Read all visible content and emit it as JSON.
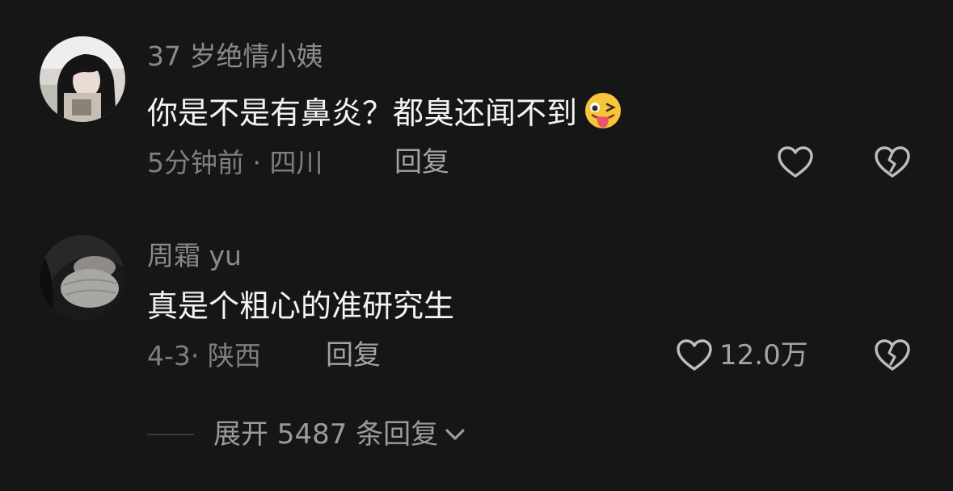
{
  "comments": [
    {
      "username": "37 岁绝情小姨",
      "text": "你是不是有鼻炎？都臭还闻不到",
      "emoji": "winking-tongue-face",
      "time_location": "5分钟前 · 四川",
      "reply_label": "回复",
      "like_count": ""
    },
    {
      "username": "周霜 yu",
      "text": "真是个粗心的准研究生",
      "time_location": "4-3· 陕西",
      "reply_label": "回复",
      "like_count": "12.0万"
    }
  ],
  "expand": {
    "label": "展开 5487 条回复"
  },
  "colors": {
    "background": "#161616",
    "username": "#8a8a8a",
    "text": "#f4f4f4",
    "meta": "#7f7f7f",
    "action": "#a3a3a3"
  }
}
